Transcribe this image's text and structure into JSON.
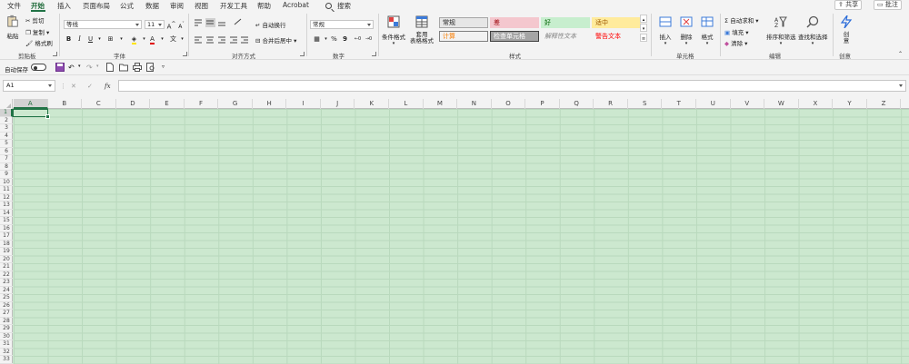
{
  "menu": {
    "tabs": [
      "文件",
      "开始",
      "插入",
      "页面布局",
      "公式",
      "数据",
      "审阅",
      "视图",
      "开发工具",
      "帮助",
      "Acrobat"
    ],
    "active_tab": "开始",
    "search": "搜索",
    "share": "共享",
    "comment": "批注"
  },
  "ribbon": {
    "clipboard": {
      "group": "剪贴板",
      "paste": "粘贴",
      "cut": "剪切",
      "copy": "复制",
      "format_painter": "格式刷"
    },
    "font": {
      "group": "字体",
      "name": "等线",
      "size": "11",
      "bold": "B",
      "italic": "I",
      "underline": "U",
      "grow": "A",
      "shrink": "A",
      "font_color_letter": "A",
      "phonetic": "文"
    },
    "alignment": {
      "group": "对齐方式",
      "wrap": "自动换行",
      "merge": "合并后居中"
    },
    "number": {
      "group": "数字",
      "format": "常规",
      "percent": "%",
      "comma": "9"
    },
    "styles": {
      "group": "样式",
      "cond_format": "条件格式",
      "table_format": "套用\n表格格式",
      "cells": [
        {
          "label": "常规",
          "bg": "#e6e6e6",
          "fg": "#222222",
          "border": "#a6a6a6"
        },
        {
          "label": "差",
          "bg": "#f4c7ce",
          "fg": "#9c0006",
          "border": "#f4c7ce"
        },
        {
          "label": "好",
          "bg": "#c7eece",
          "fg": "#006100",
          "border": "#c7eece"
        },
        {
          "label": "适中",
          "bg": "#ffeb9c",
          "fg": "#9c5700",
          "border": "#ffeb9c"
        },
        {
          "label": "计算",
          "bg": "#f2f2f2",
          "fg": "#fa7d00",
          "border": "#7f7f7f"
        },
        {
          "label": "检查单元格",
          "bg": "#a5a5a5",
          "fg": "#ffffff",
          "border": "#3f3f3f"
        },
        {
          "label": "解释性文本",
          "bg": "#f3f3f3",
          "fg": "#7f7f7f",
          "border": "#f3f3f3"
        },
        {
          "label": "警告文本",
          "bg": "#f3f3f3",
          "fg": "#ff0000",
          "border": "#f3f3f3"
        }
      ]
    },
    "cells_group": {
      "group": "单元格",
      "insert": "插入",
      "delete": "删除",
      "format": "格式"
    },
    "editing": {
      "group": "编辑",
      "autosum": "自动求和",
      "fill": "填充",
      "clear": "清除",
      "sort": "排序和筛选",
      "find": "查找和选择"
    },
    "ideas": {
      "group": "创意",
      "label": "创\n意"
    }
  },
  "qat": {
    "autosave": "自动保存"
  },
  "formula_bar": {
    "name_box": "A1",
    "formula": "",
    "fx": "fx"
  },
  "grid": {
    "columns": [
      "A",
      "B",
      "C",
      "D",
      "E",
      "F",
      "G",
      "H",
      "I",
      "J",
      "K",
      "L",
      "M",
      "N",
      "O",
      "P",
      "Q",
      "R",
      "S",
      "T",
      "U",
      "V",
      "W",
      "X",
      "Y",
      "Z"
    ],
    "rows": [
      "1",
      "2",
      "3",
      "4",
      "5",
      "6",
      "7",
      "8",
      "9",
      "10",
      "11",
      "12",
      "13",
      "14",
      "15",
      "16",
      "17",
      "18",
      "19",
      "20",
      "21",
      "22",
      "23",
      "24",
      "25",
      "26",
      "27",
      "28",
      "29",
      "30",
      "31",
      "32",
      "33"
    ],
    "active_cell": "A1",
    "cell_bg": "#cce8cf"
  },
  "colors": {
    "accent": "#217346"
  }
}
